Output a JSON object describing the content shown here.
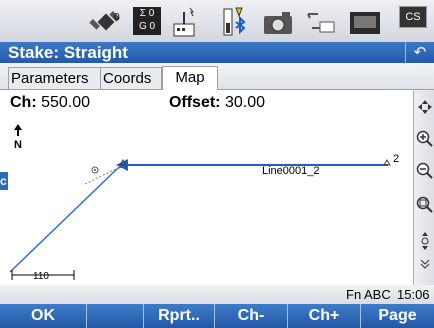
{
  "title": "Stake: Straight",
  "tabs": [
    {
      "label": "Parameters"
    },
    {
      "label": "Coords"
    },
    {
      "label": "Map"
    }
  ],
  "status": {
    "sat_gps": "0",
    "sat_glonass": "0",
    "sat_top": "Σ 0",
    "sat_bot": "G 0",
    "cs_label": "CS"
  },
  "info": {
    "ch_label": "Ch:",
    "ch_value": "550.00",
    "offset_label": "Offset:",
    "offset_value": "30.00"
  },
  "map": {
    "north_label": "N",
    "line_label": "Line0001_2",
    "point_end_label": "2",
    "scale_label": "110"
  },
  "fnbar": {
    "fn": "Fn",
    "input_mode": "ABC",
    "time": "15:06"
  },
  "softkeys": [
    {
      "label": "OK"
    },
    {
      "label": ""
    },
    {
      "label": "Rprt.."
    },
    {
      "label": "Ch-"
    },
    {
      "label": "Ch+"
    },
    {
      "label": "Page"
    }
  ],
  "side_tab_text": "c",
  "colors": {
    "accent": "#2d66b5",
    "line": "#1f5fc0"
  }
}
